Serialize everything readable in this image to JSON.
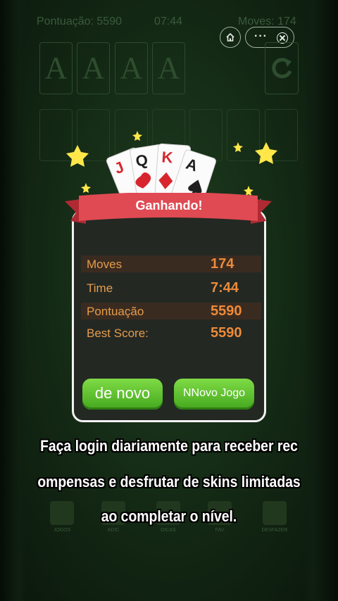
{
  "topbar": {
    "score": "Pontuação: 5590",
    "time": "07:44",
    "moves": "Moves: 174"
  },
  "foundations": [
    "A",
    "A",
    "A",
    "A"
  ],
  "stock_icon": "undo-refresh-icon",
  "miniprogram": {
    "home_icon": "home-icon",
    "more_icon": "more-dots-icon",
    "close_icon": "close-icon",
    "dots": "···"
  },
  "dialog": {
    "title": "Ganhando!",
    "cards": [
      "J",
      "Q",
      "K",
      "A"
    ],
    "stats": [
      {
        "label": "Moves",
        "value": "174"
      },
      {
        "label": "Time",
        "value": "7:44"
      },
      {
        "label": "Pontuação",
        "value": "5590"
      },
      {
        "label": "Best Score:",
        "value": "5590"
      }
    ],
    "buttons": {
      "again": "de novo",
      "new_game": "NNovo Jogo"
    }
  },
  "bottom_nav": [
    {
      "label": "JOGOS",
      "icon": "cards-icon"
    },
    {
      "label": "ADIC",
      "icon": "add-icon"
    },
    {
      "label": "DICAS",
      "icon": "hint-bulb-icon"
    },
    {
      "label": "FAV",
      "icon": "favorite-icon"
    },
    {
      "label": "DESFAZER",
      "icon": "undo-icon"
    }
  ],
  "subtitles": [
    "Faça login diariamente para receber rec",
    "ompensas e desfrutar de skins limitadas",
    "ao completar o nível."
  ],
  "colors": {
    "felt": "#1a361b",
    "ribbon": "#d9414b",
    "button": "#5cc22e",
    "stat_value": "#ec8a3a"
  }
}
